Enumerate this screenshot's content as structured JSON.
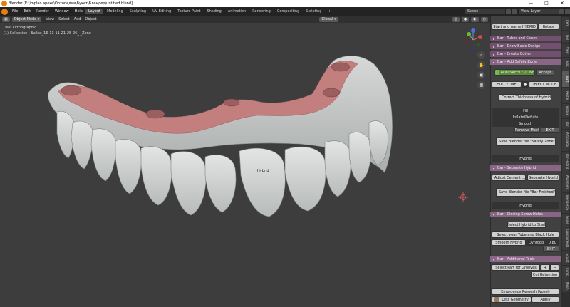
{
  "window": {
    "title": "Blender [E:\\implan apexe\\Ортопедия\\Букет\\Блендер\\untitled.blend]",
    "controls": [
      "—",
      "□",
      "✕"
    ]
  },
  "menu": {
    "items": [
      "File",
      "Edit",
      "Render",
      "Window",
      "Help"
    ]
  },
  "workspaces": {
    "tabs": [
      "Layout",
      "Modeling",
      "Sculpting",
      "UV Editing",
      "Texture Paint",
      "Shading",
      "Animation",
      "Rendering",
      "Compositing",
      "Scripting"
    ],
    "add": "+",
    "active": "Layout"
  },
  "topright": {
    "scene": "Scene",
    "view_layer": "View Layer"
  },
  "viewport_header": {
    "mode": "Object Mode",
    "menus": [
      "View",
      "Select",
      "Add",
      "Object"
    ],
    "transform": "Global"
  },
  "viewport": {
    "line1": "User Orthographic",
    "line2": "(1) Collection | Бабас_16-13-11-21-25-26_-_Zone",
    "hybrid_label": "Hybrid",
    "gizmo": {
      "x": "X",
      "y": "Y",
      "z": "Z"
    }
  },
  "panel": {
    "start": {
      "start_btn": "Start and name HYBRID",
      "rotate_btn": "Rotate"
    },
    "sec1": "Bar - Tubes and Cones",
    "sec2": "Bar - Draw Basic Design",
    "sec3": "Bar - Create Cutter",
    "sec4": "Bar - Add Safety Zone",
    "add_safety_btn": "ADD SAFETY ZONE",
    "accept_btn": "Accept",
    "edit_zone_btn": "EDIT ZONE",
    "object_mode_btn": "OBJECT MODE",
    "correct_btn": "Correct Thickness of Hybrid",
    "fill_btn": "Fill",
    "inflate_btn": "Inflate/Deflate",
    "smooth_btn": "Smooth",
    "remove_mask_btn": "Remove Mask",
    "exit_btn": "EXIT",
    "save_safety_btn": "Save Blender file \"Safety Zone\"",
    "hybrid1": "Hybrid",
    "sec5": "Bar - Separate Hybrid",
    "adjust_btn": "Adjust Cement ...",
    "separate_btn": "Separate Hybrid",
    "save_finished_btn": "Save Blender file \"Bar Finished\"",
    "hybrid2": "Hybrid",
    "sec6": "Bar - Closing Screw Holes",
    "select_hybrid_btn": "Select Hybrid to Start",
    "select_tube_btn": "Select your Tube and Black Hole",
    "smooth_hybrid_btn": "Smooth Hybrid",
    "dyntopo_label": "Dyntopo",
    "dyntopo_value": "0.80",
    "exit2_btn": "EXIT",
    "sec7": "Bar - Additional Tools",
    "select_part_btn": "Select Part for Grooves",
    "plus": "+",
    "minus": "−",
    "cut_retention_btn": "Cut Retention",
    "emergency_btn": "Emergency Remesh (Voxel)",
    "less_geometry_btn": "Less Geometry",
    "apply_btn": "Apply"
  },
  "vtabs": [
    "Item",
    "Tool",
    "View",
    "Edit",
    "Bart",
    "Restor",
    "Bridge",
    "Bar",
    "Articulator",
    "Bar-Hybrid",
    "Alignment",
    "BlenderDS",
    "Guide",
    "Components",
    "Sculpt",
    "Comp",
    "Mesh"
  ],
  "colors": {
    "accent": "#e87d0d",
    "section": "#735070",
    "gum": "#c48080",
    "teeth": "#cfd2d1"
  }
}
